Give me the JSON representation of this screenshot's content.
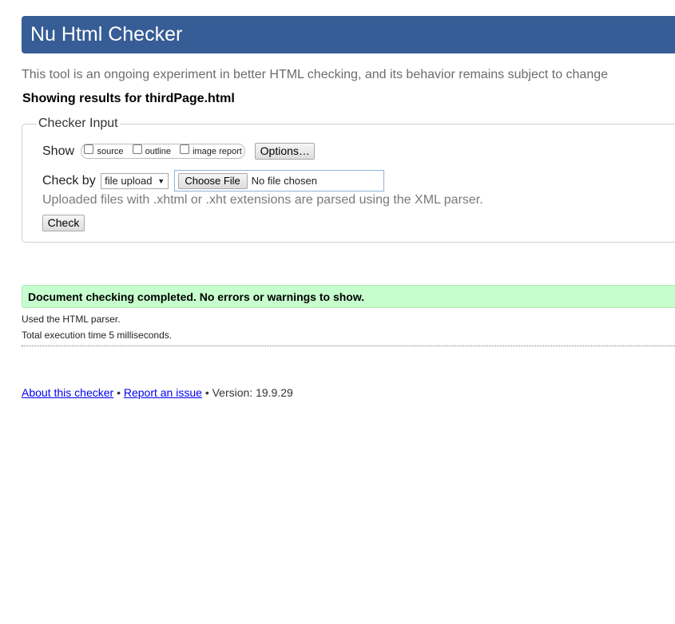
{
  "header": {
    "title": "Nu Html Checker",
    "background_color": "#365d95"
  },
  "intro_text": "This tool is an ongoing experiment in better HTML checking, and its behavior remains subject to change",
  "showing_results": "Showing results for thirdPage.html",
  "checker_input": {
    "legend": "Checker Input",
    "show_label": "Show",
    "show_options": [
      {
        "label": "source",
        "checked": false
      },
      {
        "label": "outline",
        "checked": false
      },
      {
        "label": "image report",
        "checked": false
      }
    ],
    "options_button": "Options…",
    "check_by_label": "Check by",
    "check_by_selected": "file upload",
    "choose_file_button": "Choose File",
    "file_status": "No file chosen",
    "note": "Uploaded files with .xhtml or .xht extensions are parsed using the XML parser.",
    "check_button": "Check"
  },
  "result": {
    "message": "Document checking completed. No errors or warnings to show.",
    "background_color": "#c6ffcd",
    "parser_info": "Used the HTML parser.",
    "execution_time": "Total execution time 5 milliseconds."
  },
  "footer": {
    "about_link": "About this checker",
    "separator": "•",
    "report_link": "Report an issue",
    "version_text": "Version: 19.9.29"
  }
}
